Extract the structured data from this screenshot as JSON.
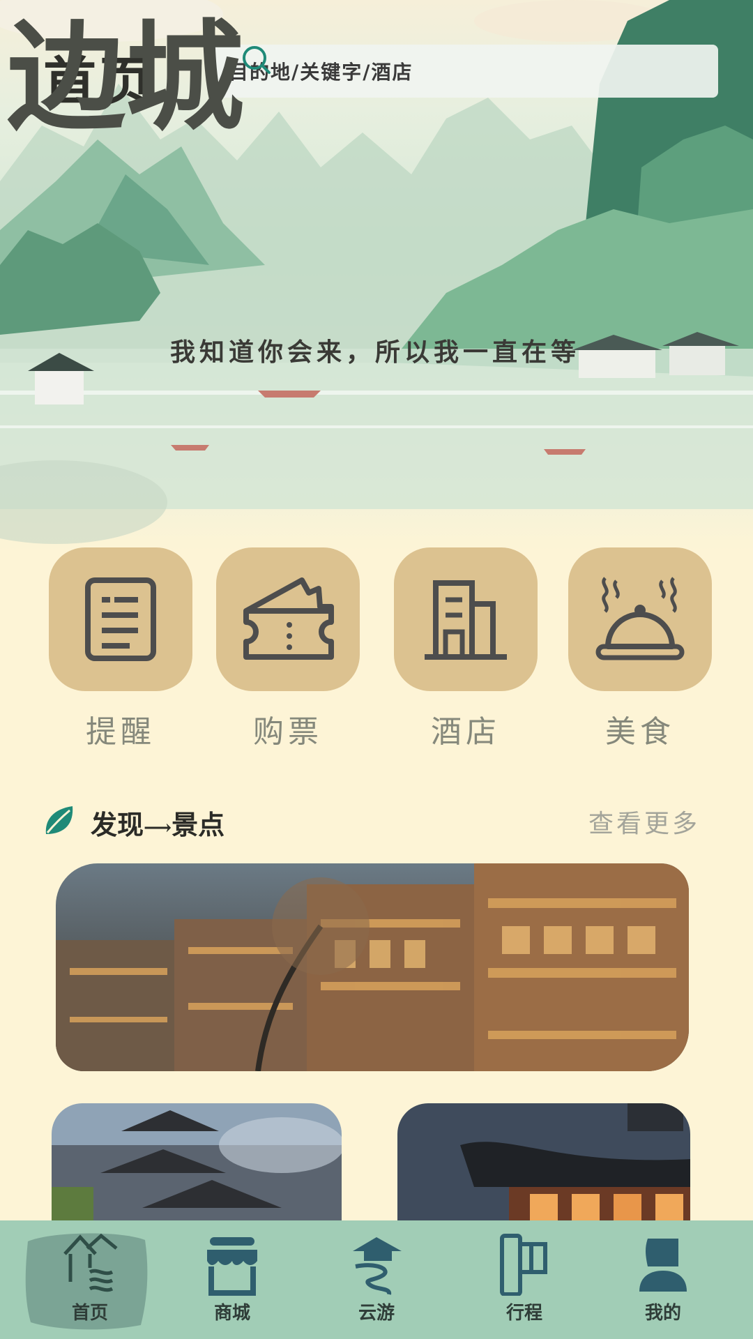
{
  "header": {
    "title": "首页",
    "search_placeholder": "目的地/关键字/酒店"
  },
  "hero": {
    "calligraphy": "边城",
    "slogan": "我知道你会来，所以我一直在等"
  },
  "features": [
    {
      "label": "提醒",
      "icon": "document-icon"
    },
    {
      "label": "购票",
      "icon": "ticket-icon"
    },
    {
      "label": "酒店",
      "icon": "hotel-building-icon"
    },
    {
      "label": "美食",
      "icon": "food-cloche-icon"
    }
  ],
  "discover": {
    "title": "发现",
    "title_suffix": "景点",
    "more": "查看更多"
  },
  "tabbar": [
    {
      "label": "首页",
      "icon": "home-pavilion-icon",
      "active": true
    },
    {
      "label": "商城",
      "icon": "shop-icon",
      "active": false
    },
    {
      "label": "云游",
      "icon": "cloud-tour-icon",
      "active": false
    },
    {
      "label": "行程",
      "icon": "flag-icon",
      "active": false
    },
    {
      "label": "我的",
      "icon": "user-icon",
      "active": false
    }
  ],
  "colors": {
    "background": "#fdf4d6",
    "tile": "#dcc290",
    "tabbar": "#a1cdb6",
    "accent": "#1f8a78"
  }
}
